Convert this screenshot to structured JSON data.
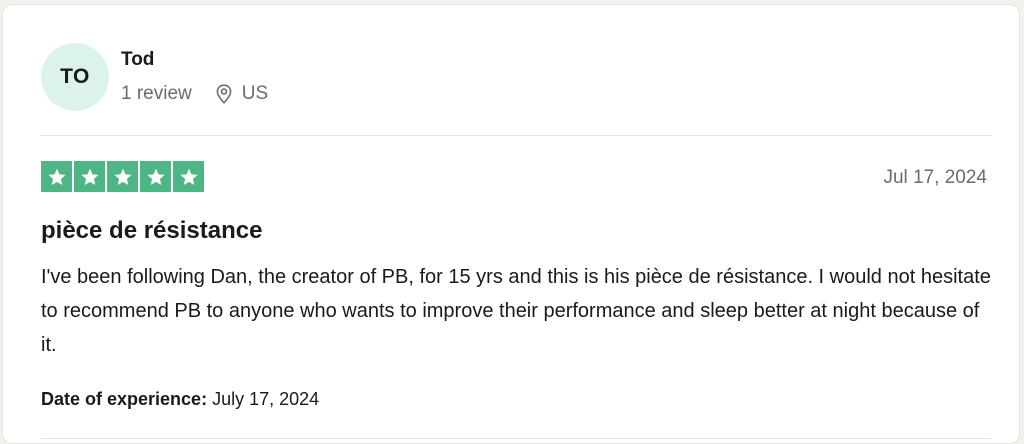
{
  "reviewer": {
    "initials": "TO",
    "name": "Tod",
    "review_count": "1 review",
    "location_icon": "location-pin-icon",
    "country": "US"
  },
  "review": {
    "rating": 5,
    "rating_max": 5,
    "star_color": "#4db586",
    "date": "Jul 17, 2024",
    "title": "pièce de résistance",
    "body": "I've been following Dan, the creator of PB, for 15 yrs and this is his pièce de résistance. I would not hesitate to recommend PB to anyone who wants to improve their performance and sleep better at night because of it.",
    "experience_label": "Date of experience:",
    "experience_date": "July 17, 2024"
  },
  "colors": {
    "avatar_bg": "#dcf3ec",
    "text_primary": "#1a1a1a",
    "text_secondary": "#6b6b6b"
  }
}
